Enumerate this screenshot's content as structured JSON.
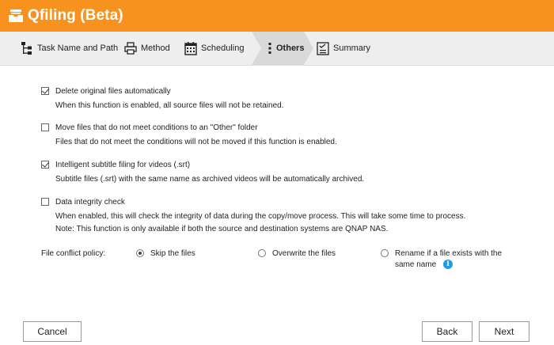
{
  "app": {
    "title": "Qfiling (Beta)"
  },
  "steps": [
    {
      "label": "Task Name and Path",
      "icon": "tree-icon"
    },
    {
      "label": "Method",
      "icon": "printer-icon"
    },
    {
      "label": "Scheduling",
      "icon": "calendar-icon"
    },
    {
      "label": "Others",
      "icon": "vertical-dots-icon",
      "active": true
    },
    {
      "label": "Summary",
      "icon": "checklist-icon"
    }
  ],
  "options": [
    {
      "label": "Delete original files automatically",
      "checked": true,
      "desc": [
        "When this function is enabled, all source files will not be retained."
      ]
    },
    {
      "label": "Move files that do not meet conditions to an \"Other\" folder",
      "checked": false,
      "desc": [
        "Files that do not meet the conditions will not be moved if this function is enabled."
      ]
    },
    {
      "label": "Intelligent subtitle filing for videos (.srt)",
      "checked": true,
      "desc": [
        "Subtitle files (.srt) with the same name as archived videos will be automatically archived."
      ]
    },
    {
      "label": "Data integrity check",
      "checked": false,
      "desc": [
        "When enabled, this will check the integrity of data during the copy/move process. This will take some time to process.",
        "Note: This function is only available if both the source and destination systems are QNAP NAS."
      ]
    }
  ],
  "policy": {
    "label": "File conflict policy:",
    "choices": [
      {
        "text": "Skip the files",
        "selected": true
      },
      {
        "text": "Overwrite the files",
        "selected": false
      },
      {
        "text_line1": "Rename if a file exists with the",
        "text_line2": "same name",
        "selected": false
      }
    ],
    "info_glyph": "i"
  },
  "buttons": {
    "cancel": "Cancel",
    "back": "Back",
    "next": "Next"
  },
  "colors": {
    "accent": "#f7921e",
    "info": "#1e9be8"
  }
}
